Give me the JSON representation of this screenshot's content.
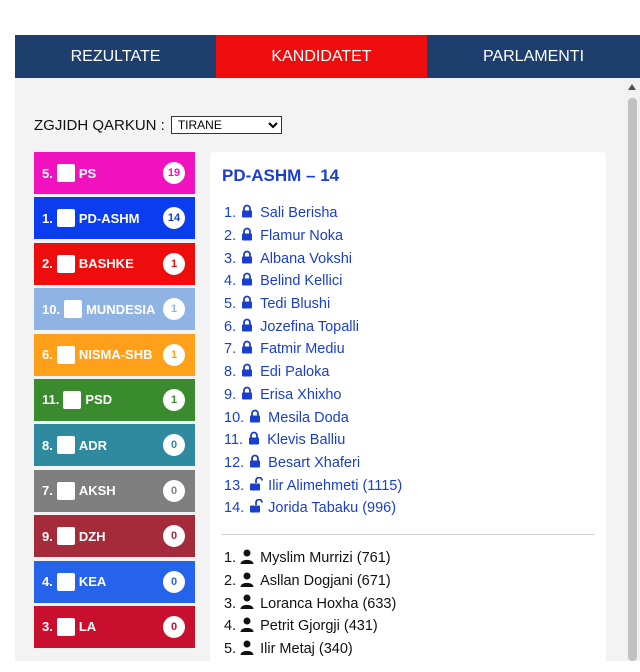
{
  "nav": {
    "tabs": [
      {
        "label": "REZULTATE"
      },
      {
        "label": "KANDIDATET"
      },
      {
        "label": "PARLAMENTI"
      }
    ]
  },
  "region": {
    "label": "ZGJIDH QARKUN :",
    "selected": "TIRANE"
  },
  "parties": [
    {
      "num": "5.",
      "name": "PS",
      "count": "19",
      "color": "#f012be",
      "count_color": "#f012be"
    },
    {
      "num": "1.",
      "name": "PD-ASHM",
      "count": "14",
      "color": "#0a3cf0",
      "count_color": "#0a3cf0"
    },
    {
      "num": "2.",
      "name": "BASHKE",
      "count": "1",
      "color": "#ee0d0d",
      "count_color": "#ee0d0d"
    },
    {
      "num": "10.",
      "name": "MUNDESIA",
      "count": "1",
      "color": "#8fb4e3",
      "count_color": "#8fb4e3"
    },
    {
      "num": "6.",
      "name": "NISMA-SHB",
      "count": "1",
      "color": "#ff9f1a",
      "count_color": "#ff9f1a"
    },
    {
      "num": "11.",
      "name": "PSD",
      "count": "1",
      "color": "#3a8a2e",
      "count_color": "#3a8a2e"
    },
    {
      "num": "8.",
      "name": "ADR",
      "count": "0",
      "color": "#2f8aa0",
      "count_color": "#2f8aa0"
    },
    {
      "num": "7.",
      "name": "AKSH",
      "count": "0",
      "color": "#7f7f7f",
      "count_color": "#7f7f7f"
    },
    {
      "num": "9.",
      "name": "DZH",
      "count": "0",
      "color": "#a52a3a",
      "count_color": "#a52a3a"
    },
    {
      "num": "4.",
      "name": "KEA",
      "count": "0",
      "color": "#2563eb",
      "count_color": "#2563eb"
    },
    {
      "num": "3.",
      "name": "LA",
      "count": "0",
      "color": "#c8102e",
      "count_color": "#c8102e"
    }
  ],
  "detail": {
    "title": "PD-ASHM – 14",
    "elected": [
      {
        "num": "1.",
        "name": "Sali Berisha",
        "lock": "locked"
      },
      {
        "num": "2.",
        "name": "Flamur Noka",
        "lock": "locked"
      },
      {
        "num": "3.",
        "name": "Albana Vokshi",
        "lock": "locked"
      },
      {
        "num": "4.",
        "name": "Belind Kellici",
        "lock": "locked"
      },
      {
        "num": "5.",
        "name": "Tedi Blushi",
        "lock": "locked"
      },
      {
        "num": "6.",
        "name": "Jozefina Topalli",
        "lock": "locked"
      },
      {
        "num": "7.",
        "name": "Fatmir Mediu",
        "lock": "locked"
      },
      {
        "num": "8.",
        "name": "Edi Paloka",
        "lock": "locked"
      },
      {
        "num": "9.",
        "name": "Erisa Xhixho",
        "lock": "locked"
      },
      {
        "num": "10.",
        "name": "Mesila Doda",
        "lock": "locked"
      },
      {
        "num": "11.",
        "name": "Klevis Balliu",
        "lock": "locked"
      },
      {
        "num": "12.",
        "name": "Besart Xhaferi",
        "lock": "locked"
      },
      {
        "num": "13.",
        "name": "Ilir Alimehmeti (1115)",
        "lock": "unlocked"
      },
      {
        "num": "14.",
        "name": "Jorida Tabaku (996)",
        "lock": "unlocked"
      }
    ],
    "candidates": [
      {
        "num": "1.",
        "name": "Myslim Murrizi (761)"
      },
      {
        "num": "2.",
        "name": "Asllan Dogjani (671)"
      },
      {
        "num": "3.",
        "name": "Loranca Hoxha (633)"
      },
      {
        "num": "4.",
        "name": "Petrit Gjorgji (431)"
      },
      {
        "num": "5.",
        "name": "Ilir Metaj (340)"
      }
    ]
  }
}
